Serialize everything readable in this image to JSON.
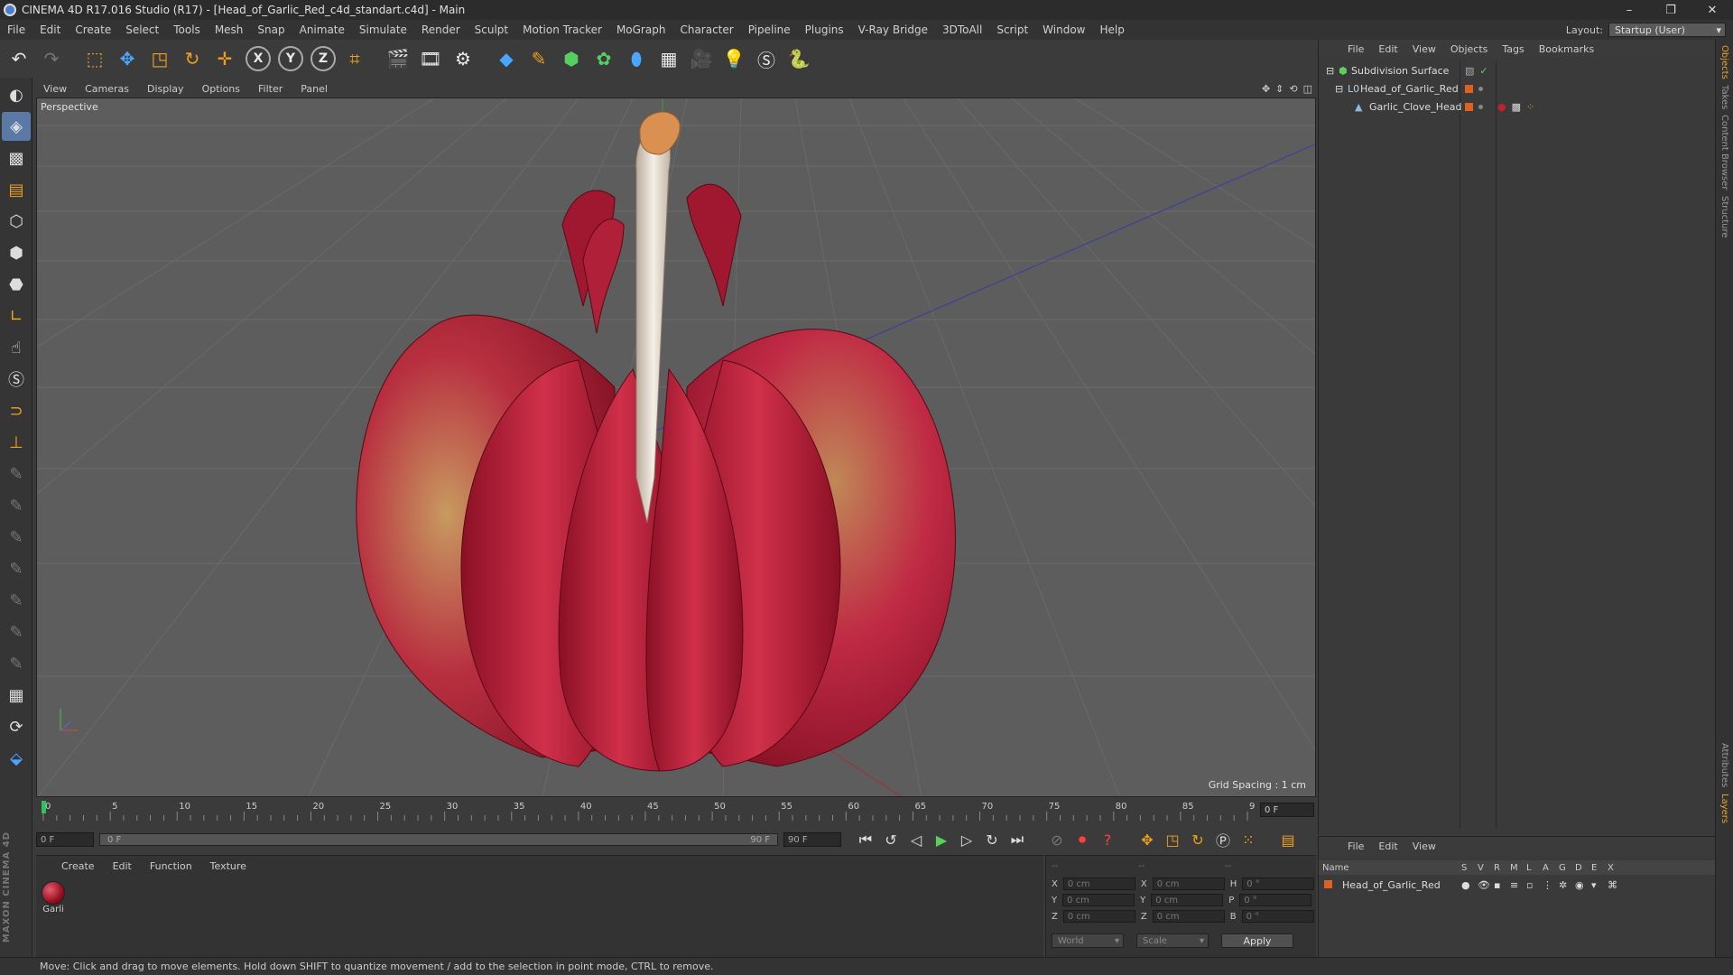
{
  "window": {
    "title": "CINEMA 4D R17.016 Studio (R17) - [Head_of_Garlic_Red_c4d_standart.c4d] - Main",
    "controls": [
      "–",
      "❐",
      "✕"
    ]
  },
  "menubar": {
    "items": [
      "File",
      "Edit",
      "Create",
      "Select",
      "Tools",
      "Mesh",
      "Snap",
      "Animate",
      "Simulate",
      "Render",
      "Sculpt",
      "Motion Tracker",
      "MoGraph",
      "Character",
      "Pipeline",
      "Plugins",
      "V-Ray Bridge",
      "3DToAll",
      "Script",
      "Window",
      "Help"
    ],
    "layout_label": "Layout:",
    "layout_value": "Startup (User)"
  },
  "viewport": {
    "menu": [
      "View",
      "Cameras",
      "Display",
      "Options",
      "Filter",
      "Panel"
    ],
    "camera_label": "Perspective",
    "grid_spacing": "Grid Spacing : 1 cm"
  },
  "timeline": {
    "ticks": [
      "0",
      "5",
      "10",
      "15",
      "20",
      "25",
      "30",
      "35",
      "40",
      "45",
      "50",
      "55",
      "60",
      "65",
      "70",
      "75",
      "80",
      "85",
      "90"
    ],
    "current_frame": "0 F"
  },
  "transport": {
    "start_field": "0 F",
    "slider_left": "0 F",
    "slider_right": "90 F",
    "end_field": "90 F"
  },
  "materials": {
    "menu": [
      "Create",
      "Edit",
      "Function",
      "Texture"
    ],
    "items": [
      {
        "name": "Garli"
      }
    ]
  },
  "coordinates": {
    "header": [
      "--",
      "--",
      "--"
    ],
    "rows": [
      {
        "axis": "X",
        "pos": "0 cm",
        "axis2": "X",
        "size": "0 cm",
        "rot_label": "H",
        "rot": "0 °"
      },
      {
        "axis": "Y",
        "pos": "0 cm",
        "axis2": "Y",
        "size": "0 cm",
        "rot_label": "P",
        "rot": "0 °"
      },
      {
        "axis": "Z",
        "pos": "0 cm",
        "axis2": "Z",
        "size": "0 cm",
        "rot_label": "B",
        "rot": "0 °"
      }
    ],
    "space_dropdown": "World",
    "mode_dropdown": "Scale",
    "apply_label": "Apply"
  },
  "objects_panel": {
    "menu": [
      "File",
      "Edit",
      "View",
      "Objects",
      "Tags",
      "Bookmarks"
    ],
    "tree": [
      {
        "name": "Subdivision Surface",
        "depth": 0
      },
      {
        "name": "Head_of_Garlic_Red",
        "depth": 1
      },
      {
        "name": "Garlic_Clove_Head",
        "depth": 2
      }
    ]
  },
  "layers_panel": {
    "menu": [
      "File",
      "Edit",
      "View"
    ],
    "columns": [
      "Name",
      "S",
      "V",
      "R",
      "M",
      "L",
      "A",
      "G",
      "D",
      "E",
      "X"
    ],
    "rows": [
      {
        "name": "Head_of_Garlic_Red"
      }
    ]
  },
  "side_tabs": [
    "Objects",
    "Takes",
    "Content Browser",
    "Structure",
    "Attributes",
    "Layers"
  ],
  "status": {
    "text": "Move: Click and drag to move elements. Hold down SHIFT to quantize movement / add to the selection in point mode, CTRL to remove."
  },
  "brand": "MAXON CINEMA 4D",
  "colors": {
    "accent_orange": "#f0a020",
    "garlic_red": "#b01830",
    "viewport_bg": "#5d5d5d"
  }
}
